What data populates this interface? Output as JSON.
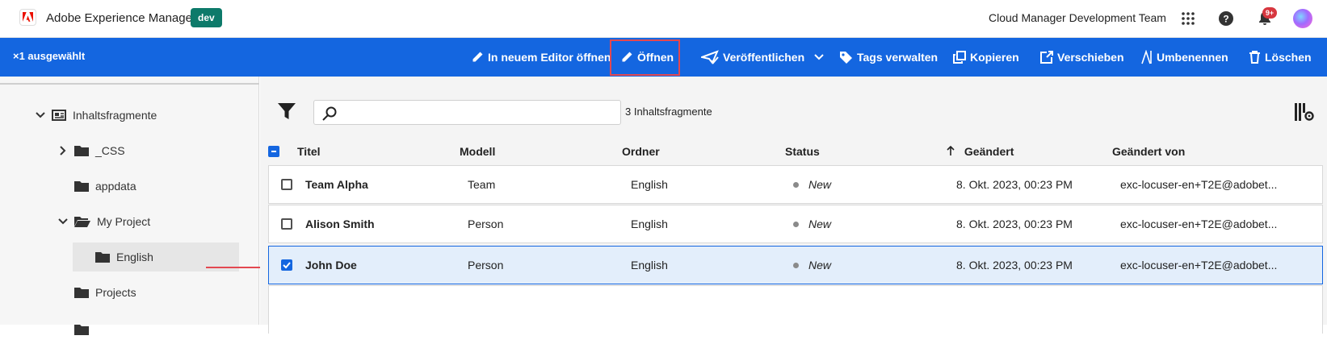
{
  "shell": {
    "app_title": "Adobe Experience Manager",
    "env_badge": "dev",
    "org_name": "Cloud Manager Development Team",
    "notification_count": "9+",
    "icons": [
      "apps-grid-icon",
      "help-icon",
      "bell-icon",
      "avatar"
    ]
  },
  "actionbar": {
    "selection_label": "1 ausgewählt",
    "actions": [
      {
        "label": "In neuem Editor öffnen",
        "icon": "pencil-icon"
      },
      {
        "label": "Öffnen",
        "icon": "pencil-icon",
        "highlighted": true
      },
      {
        "label": "Veröffentlichen",
        "icon": "publish-icon",
        "has_dropdown": true
      },
      {
        "label": "Tags verwalten",
        "icon": "tag-icon"
      },
      {
        "label": "Kopieren",
        "icon": "copy-icon"
      },
      {
        "label": "Verschieben",
        "icon": "move-icon"
      },
      {
        "label": "Umbenennen",
        "icon": "rename-icon"
      },
      {
        "label": "Löschen",
        "icon": "trash-icon"
      }
    ],
    "accent_color": "#1466e0",
    "highlight_color": "#e34850"
  },
  "tree": {
    "items": [
      {
        "label": "Inhaltsfragmente",
        "expanded": true,
        "icon": "content-fragments-icon"
      },
      {
        "label": "_CSS",
        "expanded": false,
        "icon": "folder-icon"
      },
      {
        "label": "appdata",
        "icon": "folder-icon"
      },
      {
        "label": "My Project",
        "expanded": true,
        "icon": "folder-open-icon"
      },
      {
        "label": "English",
        "selected": true,
        "icon": "folder-icon"
      },
      {
        "label": "Projects",
        "icon": "folder-icon"
      }
    ]
  },
  "content": {
    "search_placeholder": "",
    "count_label": "3 Inhaltsfragmente",
    "columns": [
      "Titel",
      "Modell",
      "Ordner",
      "Status",
      "Geändert",
      "Geändert von"
    ],
    "sort_column": "Geändert",
    "rows": [
      {
        "title": "Team Alpha",
        "model": "Team",
        "folder": "English",
        "status": "New",
        "modified": "8. Okt. 2023, 00:23 PM",
        "modified_by": "exc-locuser-en+T2E@adobet...",
        "selected": false
      },
      {
        "title": "Alison Smith",
        "model": "Person",
        "folder": "English",
        "status": "New",
        "modified": "8. Okt. 2023, 00:23 PM",
        "modified_by": "exc-locuser-en+T2E@adobet...",
        "selected": false
      },
      {
        "title": "John Doe",
        "model": "Person",
        "folder": "English",
        "status": "New",
        "modified": "8. Okt. 2023, 00:23 PM",
        "modified_by": "exc-locuser-en+T2E@adobet...",
        "selected": true
      }
    ]
  }
}
